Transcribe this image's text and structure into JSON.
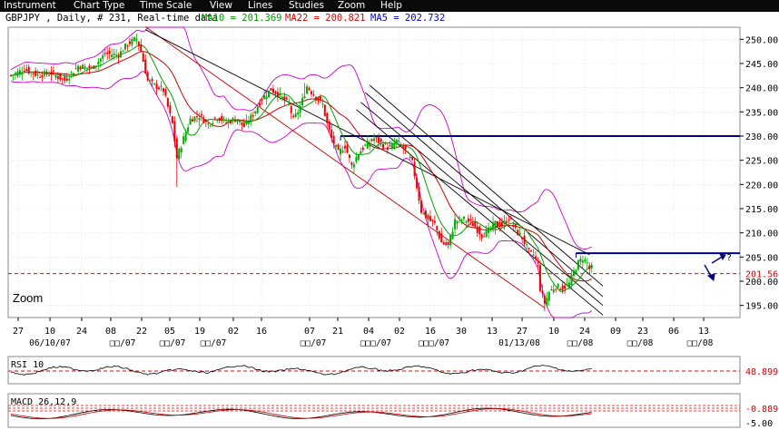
{
  "menu": [
    "Instrument",
    "Chart Type",
    "Time Scale",
    "View",
    "Lines",
    "Studies",
    "Zoom",
    "Help"
  ],
  "info": {
    "instrument": "GBPJPY , Daily, # 231, Real-time data",
    "ma10": "MA10 = 201.369",
    "ma22": "MA22 = 200.821",
    "ma5": "MA5 = 202.732"
  },
  "zoom_label": "Zoom",
  "colors": {
    "up": "#00aa00",
    "down": "#ee0000",
    "ma10": "#00a000",
    "ma22": "#cc0000",
    "bollinger": "#cc00cc",
    "channel": "#000000",
    "level": "#000080",
    "dashed_level": "#ee0000",
    "arrow": "#000080",
    "grid": "#d8d8d8"
  },
  "chart_data": [
    {
      "type": "candlestick",
      "title": "GBPJPY , Daily",
      "y_ticks": [
        195.0,
        200.0,
        205.0,
        210.0,
        215.0,
        220.0,
        225.0,
        230.0,
        235.0,
        240.0,
        245.0,
        250.0
      ],
      "y_tick_labels": [
        "195.00",
        "200.00",
        "205.00",
        "210.00",
        "215.00",
        "220.00",
        "225.00",
        "230.00",
        "235.00",
        "240.00",
        "245.00",
        "250.00"
      ],
      "ylim": [
        192.5,
        252.5
      ],
      "x_ticks": [
        "27",
        "10",
        "24",
        "08",
        "22",
        "05",
        "19",
        "02",
        "16",
        "07",
        "21",
        "04",
        "02",
        "16",
        "30",
        "13",
        "27",
        "10",
        "24",
        "09",
        "23",
        "06",
        "13"
      ],
      "x_month_labels": [
        "06/10/07",
        "□□/07",
        "□□/07",
        "□□/07",
        "□□/07",
        "□□□/07",
        "□□□/07",
        "01/13/08",
        "□□/08",
        "□□/08",
        "□□/08"
      ],
      "horizontal_levels": [
        230.0,
        205.8
      ],
      "current_level": 201.56,
      "current_level_label": "201.56",
      "price_points": [
        [
          0,
          242.5
        ],
        [
          6,
          243.8
        ],
        [
          12,
          242.6
        ],
        [
          18,
          243.0
        ],
        [
          24,
          241.5
        ],
        [
          30,
          244.5
        ],
        [
          36,
          244.0
        ],
        [
          42,
          247.0
        ],
        [
          48,
          246.8
        ],
        [
          52,
          249.0
        ],
        [
          56,
          250.2
        ],
        [
          58,
          247.5
        ],
        [
          61,
          241.5
        ],
        [
          64,
          240.5
        ],
        [
          68,
          239.5
        ],
        [
          72,
          232.5
        ],
        [
          74,
          225.5
        ],
        [
          77,
          229.5
        ],
        [
          80,
          233.5
        ],
        [
          84,
          234.2
        ],
        [
          88,
          232.5
        ],
        [
          92,
          234.0
        ],
        [
          96,
          232.8
        ],
        [
          100,
          233.5
        ],
        [
          104,
          232.0
        ],
        [
          108,
          234.5
        ],
        [
          112,
          237.8
        ],
        [
          116,
          239.7
        ],
        [
          120,
          238.3
        ],
        [
          124,
          236.5
        ],
        [
          126,
          233.3
        ],
        [
          129,
          236.0
        ],
        [
          132,
          240.3
        ],
        [
          136,
          238.0
        ],
        [
          139,
          236.5
        ],
        [
          141,
          232.5
        ],
        [
          143,
          229.5
        ],
        [
          146,
          226.5
        ],
        [
          149,
          228.0
        ],
        [
          152,
          223.8
        ],
        [
          155,
          226.5
        ],
        [
          158,
          228.0
        ],
        [
          162,
          229.5
        ],
        [
          166,
          228.2
        ],
        [
          169,
          227.5
        ],
        [
          172,
          229.0
        ],
        [
          176,
          227.0
        ],
        [
          179,
          224.5
        ],
        [
          181,
          219.5
        ],
        [
          183,
          214.5
        ],
        [
          186,
          212.8
        ],
        [
          189,
          211.8
        ],
        [
          192,
          208.0
        ],
        [
          195,
          207.3
        ],
        [
          198,
          212.5
        ],
        [
          202,
          212.8
        ],
        [
          206,
          211.8
        ],
        [
          210,
          209.5
        ],
        [
          213,
          210.5
        ],
        [
          216,
          212.0
        ],
        [
          219,
          211.5
        ],
        [
          222,
          213.2
        ],
        [
          225,
          210.5
        ],
        [
          228,
          209.0
        ],
        [
          231,
          206.0
        ],
        [
          233,
          205.5
        ],
        [
          235,
          203.5
        ],
        [
          236,
          198.5
        ],
        [
          238,
          195.5
        ],
        [
          240,
          197.8
        ],
        [
          243,
          199.0
        ],
        [
          246,
          198.5
        ],
        [
          249,
          199.5
        ],
        [
          251,
          202.0
        ],
        [
          253,
          203.8
        ],
        [
          255,
          204.8
        ],
        [
          257,
          203.8
        ],
        [
          258,
          202.5
        ],
        [
          259,
          202.73
        ]
      ]
    },
    {
      "type": "line",
      "title": "RSI 10",
      "value_label": "48.899",
      "level": 48.899
    },
    {
      "type": "line",
      "title": "MACD 26,12,9",
      "value_labels": [
        "-0.889",
        "-5.00"
      ],
      "levels": [
        -0.889,
        -5.0
      ]
    }
  ]
}
